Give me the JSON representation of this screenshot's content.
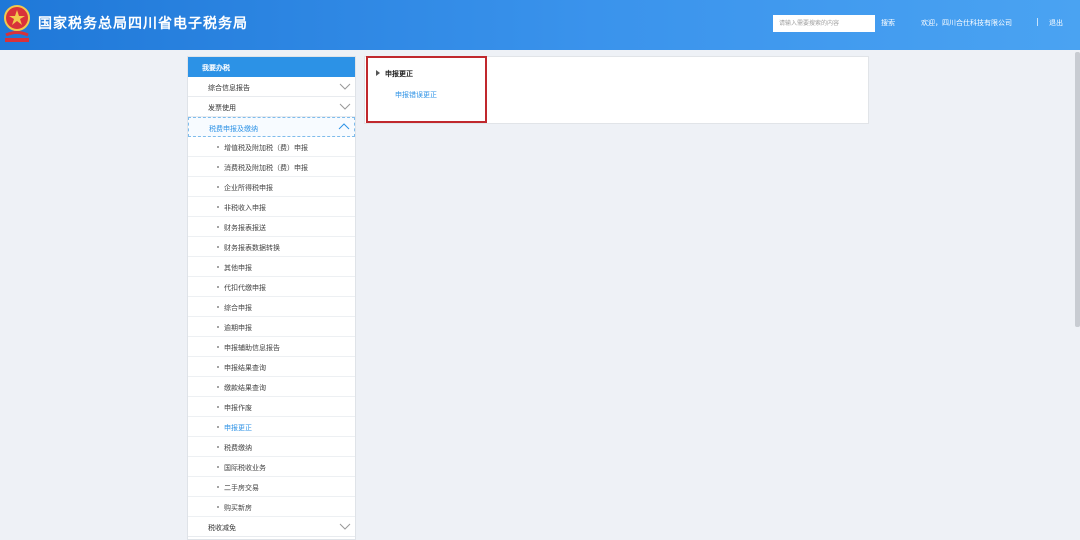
{
  "header": {
    "site_title": "国家税务总局四川省电子税务局",
    "search_placeholder": "请输入需要搜索的内容",
    "search_label": "搜索",
    "welcome_text": "欢迎，四川合仕科技有限公司",
    "separator": "|",
    "logout_label": "退出"
  },
  "colors": {
    "header_blue": "#2c92e6",
    "highlight_red": "#c0282d",
    "link_blue": "#2c92e6"
  },
  "sidebar": {
    "header": "我要办税",
    "items": [
      {
        "label": "综合信息报告",
        "icon": "chevron-down-icon"
      },
      {
        "label": "发票使用",
        "icon": "chevron-down-icon"
      },
      {
        "label": "税费申报及缴纳",
        "icon": "chevron-up-icon",
        "expanded": true
      },
      {
        "label": "税收减免",
        "icon": "chevron-down-icon"
      }
    ],
    "subitems": [
      {
        "label": "增值税及附加税（费）申报"
      },
      {
        "label": "消费税及附加税（费）申报"
      },
      {
        "label": "企业所得税申报"
      },
      {
        "label": "非税收入申报"
      },
      {
        "label": "财务报表报送"
      },
      {
        "label": "财务报表数据转换"
      },
      {
        "label": "其他申报"
      },
      {
        "label": "代扣代缴申报"
      },
      {
        "label": "综合申报"
      },
      {
        "label": "逾期申报"
      },
      {
        "label": "申报辅助信息报告"
      },
      {
        "label": "申报结果查询"
      },
      {
        "label": "缴款结果查询"
      },
      {
        "label": "申报作废"
      },
      {
        "label": "申报更正",
        "active": true
      },
      {
        "label": "税费缴纳"
      },
      {
        "label": "国际税收业务"
      },
      {
        "label": "二手房交易"
      },
      {
        "label": "购买新房"
      }
    ]
  },
  "content": {
    "section_title": "申报更正",
    "link_label": "申报错误更正"
  }
}
